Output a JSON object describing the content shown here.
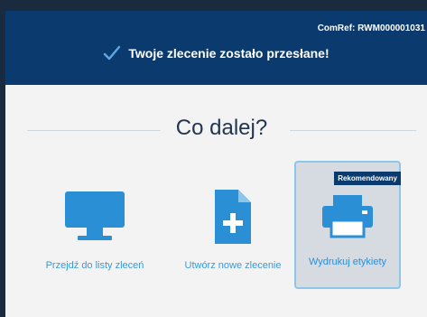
{
  "banner": {
    "comref": "ComRef: RWM000001031",
    "success_message": "Twoje zlecenie zostało przesłane!"
  },
  "main": {
    "heading": "Co dalej?",
    "options": [
      {
        "label": "Przejdź do listy zleceń",
        "icon": "monitor-icon"
      },
      {
        "label": "Utwórz nowe zlecenie",
        "icon": "new-document-icon"
      },
      {
        "label": "Wydrukuj etykiety",
        "icon": "printer-icon",
        "badge": "Rekomendowany"
      }
    ]
  },
  "colors": {
    "banner_bg": "#0b3a6e",
    "accent_blue": "#3a9ad9",
    "heading": "#1f3550"
  }
}
